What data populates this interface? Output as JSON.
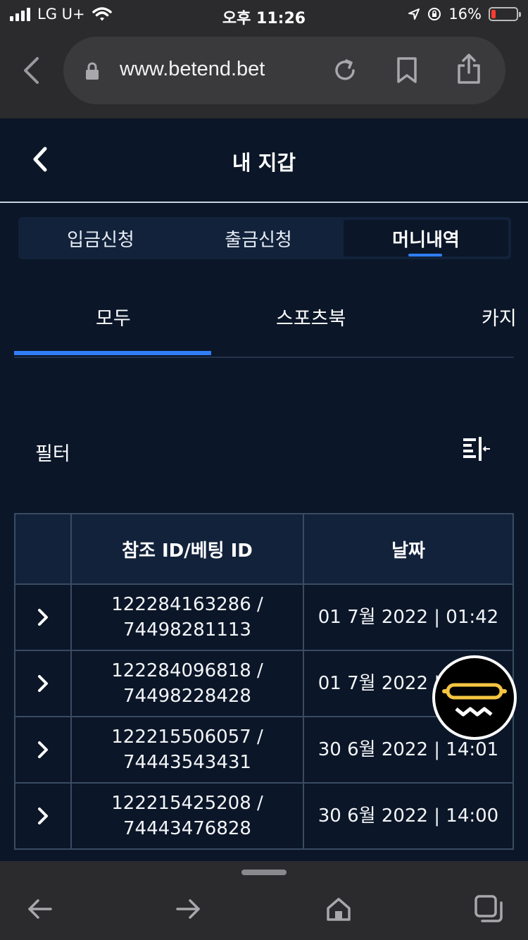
{
  "status_bar": {
    "carrier": "LG U+",
    "time": "오후 11:26",
    "battery_percent": "16%",
    "battery_level": 0.16
  },
  "browser": {
    "url": "www.betend.bet"
  },
  "header": {
    "title": "내 지갑"
  },
  "segment_tabs": [
    {
      "label": "입금신청",
      "active": false
    },
    {
      "label": "출금신청",
      "active": false
    },
    {
      "label": "머니내역",
      "active": true
    }
  ],
  "sub_tabs": [
    {
      "label": "모두",
      "active": true
    },
    {
      "label": "스포츠북",
      "active": false
    },
    {
      "label": "카지",
      "active": false
    }
  ],
  "filter": {
    "label": "필터"
  },
  "table": {
    "columns": [
      "",
      "참조 ID/베팅 ID",
      "날짜"
    ],
    "rows": [
      {
        "ref_id": "122284163286 /",
        "bet_id": "74498281113",
        "date": "01 7월 2022 | 01:42"
      },
      {
        "ref_id": "122284096818 /",
        "bet_id": "74498228428",
        "date": "01 7월 2022 | 01:42"
      },
      {
        "ref_id": "122215506057 /",
        "bet_id": "74443543431",
        "date": "30 6월 2022 | 14:01"
      },
      {
        "ref_id": "122215425208 /",
        "bet_id": "74443476828",
        "date": "30 6월 2022 | 14:00"
      }
    ]
  },
  "colors": {
    "background": "#0b1628",
    "accent": "#2f7ef5",
    "table_header": "#12223b",
    "browser_chrome": "#2b2b2d",
    "float_logo": "#f5c542"
  }
}
